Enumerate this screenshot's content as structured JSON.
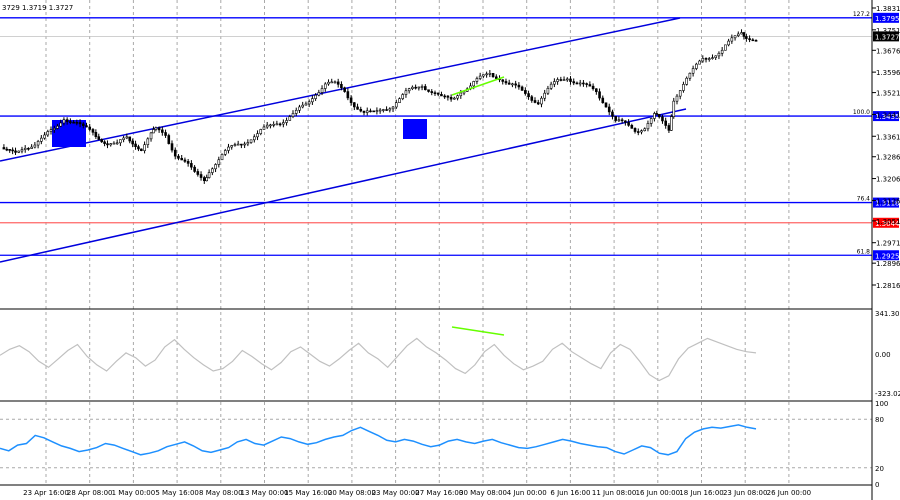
{
  "header": {
    "ohlc": "3729 1.3719 1.3727"
  },
  "colors": {
    "level": "#0000ff",
    "trendline": "#0000dd",
    "resistance": "#ff6666",
    "divergence": "#66ff00",
    "cci": "#c0c0c0",
    "rsi": "#1e90ff",
    "price_label_bg": "#0000ff",
    "red_label_bg": "#ff0000",
    "grid": "#a9a9a9"
  },
  "chart_data": [
    {
      "type": "candlestick",
      "title": "",
      "ylim": [
        1.2816,
        1.3831
      ],
      "y_ticks": [
        "1.3831",
        "1.3751",
        "1.3676",
        "1.3596",
        "1.3521",
        "1.3441",
        "1.3361",
        "1.3286",
        "1.3206",
        "1.3126",
        "1.3051",
        "1.2971",
        "1.2896",
        "1.2816"
      ],
      "x_ticks": [
        "23 Apr 16:00",
        "28 Apr 08:00",
        "1 May 00:00",
        "5 May 16:00",
        "8 May 08:00",
        "13 May 00:00",
        "15 May 16:00",
        "20 May 08:00",
        "23 May 00:00",
        "27 May 16:00",
        "30 May 08:00",
        "4 Jun 00:00",
        "6 Jun 16:00",
        "11 Jun 08:00",
        "16 Jun 00:00",
        "18 Jun 16:00",
        "23 Jun 08:00",
        "26 Jun 00:00"
      ],
      "current_price": "1.3727",
      "horizontal_levels": [
        {
          "value": 1.3795,
          "label": "1.3795",
          "fib": "127.2"
        },
        {
          "value": 1.3435,
          "label": "1.3435",
          "fib": "100.0"
        },
        {
          "value": 1.3118,
          "label": "1.3118",
          "fib": "76.4"
        },
        {
          "value": 1.3044,
          "label": "1.3044",
          "fib": ""
        },
        {
          "value": 1.2925,
          "label": "1.2925",
          "fib": "61.8"
        }
      ],
      "close_path": [
        [
          0,
          1.332
        ],
        [
          6,
          1.329
        ],
        [
          10,
          1.332
        ],
        [
          14,
          1.334
        ],
        [
          18,
          1.336
        ],
        [
          22,
          1.338
        ],
        [
          26,
          1.343
        ],
        [
          30,
          1.342
        ],
        [
          34,
          1.339
        ],
        [
          38,
          1.337
        ],
        [
          44,
          1.334
        ],
        [
          48,
          1.333
        ],
        [
          52,
          1.335
        ],
        [
          58,
          1.332
        ],
        [
          62,
          1.337
        ],
        [
          64,
          1.338
        ],
        [
          68,
          1.336
        ],
        [
          72,
          1.33
        ],
        [
          76,
          1.327
        ],
        [
          80,
          1.322
        ],
        [
          84,
          1.32
        ],
        [
          86,
          1.324
        ],
        [
          90,
          1.328
        ],
        [
          94,
          1.331
        ],
        [
          98,
          1.333
        ],
        [
          102,
          1.335
        ],
        [
          106,
          1.337
        ],
        [
          110,
          1.339
        ],
        [
          114,
          1.341
        ],
        [
          118,
          1.343
        ],
        [
          122,
          1.345
        ],
        [
          126,
          1.347
        ],
        [
          130,
          1.352
        ],
        [
          134,
          1.356
        ],
        [
          138,
          1.355
        ],
        [
          142,
          1.352
        ],
        [
          146,
          1.348
        ],
        [
          150,
          1.345
        ],
        [
          154,
          1.344
        ],
        [
          158,
          1.346
        ],
        [
          162,
          1.348
        ],
        [
          166,
          1.351
        ],
        [
          170,
          1.353
        ],
        [
          174,
          1.355
        ],
        [
          178,
          1.353
        ],
        [
          182,
          1.35
        ],
        [
          186,
          1.349
        ],
        [
          190,
          1.353
        ],
        [
          194,
          1.355
        ],
        [
          198,
          1.357
        ],
        [
          202,
          1.359
        ],
        [
          206,
          1.358
        ],
        [
          210,
          1.355
        ],
        [
          214,
          1.353
        ],
        [
          218,
          1.351
        ],
        [
          222,
          1.349
        ],
        [
          226,
          1.353
        ],
        [
          230,
          1.356
        ],
        [
          234,
          1.358
        ],
        [
          238,
          1.356
        ],
        [
          242,
          1.354
        ],
        [
          246,
          1.352
        ],
        [
          250,
          1.348
        ],
        [
          254,
          1.342
        ],
        [
          258,
          1.34
        ],
        [
          262,
          1.338
        ],
        [
          266,
          1.34
        ],
        [
          270,
          1.344
        ],
        [
          272,
          1.342
        ],
        [
          276,
          1.338
        ],
        [
          278,
          1.35
        ],
        [
          282,
          1.356
        ],
        [
          286,
          1.36
        ],
        [
          290,
          1.364
        ],
        [
          294,
          1.366
        ],
        [
          298,
          1.368
        ],
        [
          302,
          1.371
        ],
        [
          306,
          1.374
        ],
        [
          308,
          1.373
        ],
        [
          312,
          1.372
        ]
      ]
    },
    {
      "type": "line",
      "title": "",
      "ylim": [
        -323.021,
        341.3079
      ],
      "y_ticks": [
        "341.3079",
        "0.00",
        "-323.021"
      ],
      "series": [
        {
          "values": [
            -10,
            40,
            70,
            20,
            -60,
            -110,
            -40,
            30,
            80,
            -20,
            -90,
            -140,
            -60,
            10,
            -30,
            -100,
            -50,
            60,
            120,
            40,
            -30,
            -90,
            -140,
            -120,
            -60,
            30,
            -20,
            -80,
            -130,
            -70,
            20,
            60,
            0,
            -60,
            -100,
            -40,
            30,
            90,
            10,
            -40,
            -110,
            -20,
            70,
            130,
            60,
            10,
            -50,
            -120,
            -160,
            -90,
            20,
            80,
            -10,
            -80,
            -130,
            -100,
            -60,
            40,
            90,
            20,
            -30,
            -80,
            -120,
            10,
            80,
            40,
            -60,
            -170,
            -220,
            -180,
            -40,
            50,
            90,
            130,
            100,
            70,
            40,
            20,
            10
          ]
        }
      ]
    },
    {
      "type": "line",
      "title": "",
      "ylim": [
        0,
        100
      ],
      "y_ticks": [
        "100",
        "80",
        "20",
        "0"
      ],
      "series": [
        {
          "values": [
            44,
            41,
            48,
            50,
            60,
            57,
            52,
            47,
            44,
            40,
            42,
            45,
            50,
            48,
            44,
            40,
            36,
            38,
            41,
            46,
            49,
            52,
            47,
            41,
            39,
            42,
            45,
            52,
            55,
            50,
            48,
            53,
            58,
            56,
            52,
            49,
            51,
            55,
            58,
            60,
            66,
            70,
            65,
            60,
            54,
            52,
            55,
            53,
            49,
            46,
            48,
            53,
            55,
            52,
            50,
            53,
            55,
            51,
            48,
            45,
            44,
            46,
            49,
            52,
            55,
            53,
            50,
            48,
            46,
            45,
            40,
            37,
            42,
            47,
            45,
            38,
            36,
            40,
            56,
            64,
            68,
            70,
            69,
            71,
            73,
            70,
            68
          ]
        }
      ]
    }
  ],
  "annotations": {
    "fib_labels": [
      "127.2",
      "100.0",
      "76.4",
      "61.8"
    ]
  }
}
